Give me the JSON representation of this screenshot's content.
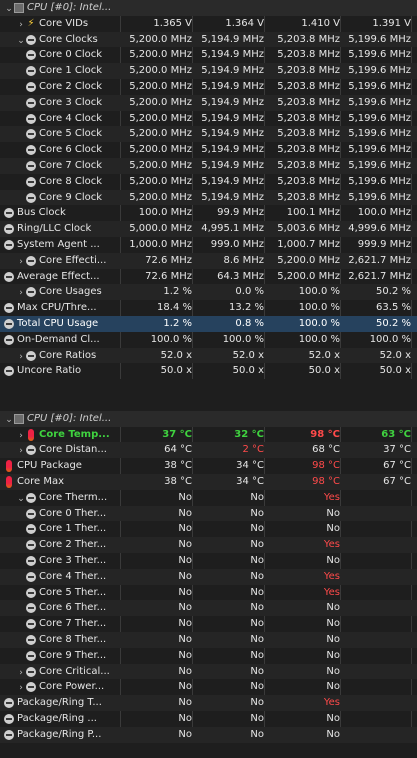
{
  "colors": {
    "green": "#3fd23f",
    "red": "#ff4a4a",
    "selected_bg": "#26425e"
  },
  "rows": [
    {
      "type": "group",
      "label": "CPU [#0]: Intel...",
      "icon": "hardware-icon",
      "arrow": "expanded"
    },
    {
      "indent": 1,
      "arrow": "collapsed",
      "icon": "lightning-icon",
      "label": "Core VIDs",
      "v": [
        "1.365 V",
        "1.364 V",
        "1.410 V",
        "1.391 V"
      ]
    },
    {
      "indent": 1,
      "arrow": "expanded",
      "icon": "circle-minus-icon",
      "label": "Core Clocks",
      "v": [
        "5,200.0 MHz",
        "5,194.9 MHz",
        "5,203.8 MHz",
        "5,199.6 MHz"
      ]
    },
    {
      "indent": 2,
      "icon": "circle-minus-icon",
      "label": "Core 0 Clock",
      "v": [
        "5,200.0 MHz",
        "5,194.9 MHz",
        "5,203.8 MHz",
        "5,199.6 MHz"
      ]
    },
    {
      "indent": 2,
      "icon": "circle-minus-icon",
      "label": "Core 1 Clock",
      "v": [
        "5,200.0 MHz",
        "5,194.9 MHz",
        "5,203.8 MHz",
        "5,199.6 MHz"
      ]
    },
    {
      "indent": 2,
      "icon": "circle-minus-icon",
      "label": "Core 2 Clock",
      "v": [
        "5,200.0 MHz",
        "5,194.9 MHz",
        "5,203.8 MHz",
        "5,199.6 MHz"
      ]
    },
    {
      "indent": 2,
      "icon": "circle-minus-icon",
      "label": "Core 3 Clock",
      "v": [
        "5,200.0 MHz",
        "5,194.9 MHz",
        "5,203.8 MHz",
        "5,199.6 MHz"
      ]
    },
    {
      "indent": 2,
      "icon": "circle-minus-icon",
      "label": "Core 4 Clock",
      "v": [
        "5,200.0 MHz",
        "5,194.9 MHz",
        "5,203.8 MHz",
        "5,199.6 MHz"
      ]
    },
    {
      "indent": 2,
      "icon": "circle-minus-icon",
      "label": "Core 5 Clock",
      "v": [
        "5,200.0 MHz",
        "5,194.9 MHz",
        "5,203.8 MHz",
        "5,199.6 MHz"
      ]
    },
    {
      "indent": 2,
      "icon": "circle-minus-icon",
      "label": "Core 6 Clock",
      "v": [
        "5,200.0 MHz",
        "5,194.9 MHz",
        "5,203.8 MHz",
        "5,199.6 MHz"
      ]
    },
    {
      "indent": 2,
      "icon": "circle-minus-icon",
      "label": "Core 7 Clock",
      "v": [
        "5,200.0 MHz",
        "5,194.9 MHz",
        "5,203.8 MHz",
        "5,199.6 MHz"
      ]
    },
    {
      "indent": 2,
      "icon": "circle-minus-icon",
      "label": "Core 8 Clock",
      "v": [
        "5,200.0 MHz",
        "5,194.9 MHz",
        "5,203.8 MHz",
        "5,199.6 MHz"
      ]
    },
    {
      "indent": 2,
      "icon": "circle-minus-icon",
      "label": "Core 9 Clock",
      "v": [
        "5,200.0 MHz",
        "5,194.9 MHz",
        "5,203.8 MHz",
        "5,199.6 MHz"
      ]
    },
    {
      "indent": 0,
      "icon": "circle-minus-icon",
      "label": "Bus Clock",
      "v": [
        "100.0 MHz",
        "99.9 MHz",
        "100.1 MHz",
        "100.0 MHz"
      ]
    },
    {
      "indent": 0,
      "icon": "circle-minus-icon",
      "label": "Ring/LLC Clock",
      "v": [
        "5,000.0 MHz",
        "4,995.1 MHz",
        "5,003.6 MHz",
        "4,999.6 MHz"
      ]
    },
    {
      "indent": 0,
      "icon": "circle-minus-icon",
      "label": "System Agent ...",
      "v": [
        "1,000.0 MHz",
        "999.0 MHz",
        "1,000.7 MHz",
        "999.9 MHz"
      ]
    },
    {
      "indent": 1,
      "arrow": "collapsed",
      "icon": "circle-minus-icon",
      "label": "Core Effecti...",
      "v": [
        "72.6 MHz",
        "8.6 MHz",
        "5,200.0 MHz",
        "2,621.7 MHz"
      ]
    },
    {
      "indent": 0,
      "icon": "circle-minus-icon",
      "label": "Average Effect...",
      "v": [
        "72.6 MHz",
        "64.3 MHz",
        "5,200.0 MHz",
        "2,621.7 MHz"
      ]
    },
    {
      "indent": 1,
      "arrow": "collapsed",
      "icon": "circle-minus-icon",
      "label": "Core Usages",
      "v": [
        "1.2 %",
        "0.0 %",
        "100.0 %",
        "50.2 %"
      ]
    },
    {
      "indent": 0,
      "icon": "circle-minus-icon",
      "label": "Max CPU/Thre...",
      "v": [
        "18.4 %",
        "13.2 %",
        "100.0 %",
        "63.5 %"
      ]
    },
    {
      "indent": 0,
      "icon": "circle-minus-icon",
      "label": "Total CPU Usage",
      "v": [
        "1.2 %",
        "0.8 %",
        "100.0 %",
        "50.2 %"
      ],
      "selected": true
    },
    {
      "indent": 0,
      "icon": "circle-minus-icon",
      "label": "On-Demand Cl...",
      "v": [
        "100.0 %",
        "100.0 %",
        "100.0 %",
        "100.0 %"
      ]
    },
    {
      "indent": 1,
      "arrow": "collapsed",
      "icon": "circle-minus-icon",
      "label": "Core Ratios",
      "v": [
        "52.0 x",
        "52.0 x",
        "52.0 x",
        "52.0 x"
      ]
    },
    {
      "indent": 0,
      "icon": "circle-minus-icon",
      "label": "Uncore Ratio",
      "v": [
        "50.0 x",
        "50.0 x",
        "50.0 x",
        "50.0 x"
      ]
    },
    {
      "type": "blank"
    },
    {
      "type": "blank"
    },
    {
      "type": "group",
      "label": "CPU [#0]: Intel...",
      "icon": "hardware-icon",
      "arrow": "expanded"
    },
    {
      "indent": 1,
      "arrow": "collapsed",
      "icon": "thermometer-icon",
      "label": "Core Temp...",
      "v": [
        "37 °C",
        "32 °C",
        "98 °C",
        "63 °C"
      ],
      "cls": [
        "green",
        "green",
        "redb",
        "green"
      ],
      "labelcls": "green"
    },
    {
      "indent": 1,
      "arrow": "collapsed",
      "icon": "circle-minus-icon",
      "label": "Core Distan...",
      "v": [
        "64 °C",
        "2 °C",
        "68 °C",
        "37 °C"
      ],
      "cls": [
        "",
        "red",
        "",
        ""
      ]
    },
    {
      "indent": 0,
      "icon": "thermometer-icon",
      "label": "CPU Package",
      "v": [
        "38 °C",
        "34 °C",
        "98 °C",
        "67 °C"
      ],
      "cls": [
        "",
        "",
        "red",
        ""
      ]
    },
    {
      "indent": 0,
      "icon": "thermometer-icon",
      "label": "Core Max",
      "v": [
        "38 °C",
        "34 °C",
        "98 °C",
        "67 °C"
      ],
      "cls": [
        "",
        "",
        "red",
        ""
      ]
    },
    {
      "indent": 1,
      "arrow": "expanded",
      "icon": "circle-minus-icon",
      "label": "Core Therm...",
      "v": [
        "No",
        "No",
        "Yes",
        ""
      ],
      "cls": [
        "",
        "",
        "red",
        ""
      ]
    },
    {
      "indent": 2,
      "icon": "circle-minus-icon",
      "label": "Core 0 Ther...",
      "v": [
        "No",
        "No",
        "No",
        ""
      ]
    },
    {
      "indent": 2,
      "icon": "circle-minus-icon",
      "label": "Core 1 Ther...",
      "v": [
        "No",
        "No",
        "No",
        ""
      ]
    },
    {
      "indent": 2,
      "icon": "circle-minus-icon",
      "label": "Core 2 Ther...",
      "v": [
        "No",
        "No",
        "Yes",
        ""
      ],
      "cls": [
        "",
        "",
        "red",
        ""
      ]
    },
    {
      "indent": 2,
      "icon": "circle-minus-icon",
      "label": "Core 3 Ther...",
      "v": [
        "No",
        "No",
        "No",
        ""
      ]
    },
    {
      "indent": 2,
      "icon": "circle-minus-icon",
      "label": "Core 4 Ther...",
      "v": [
        "No",
        "No",
        "Yes",
        ""
      ],
      "cls": [
        "",
        "",
        "red",
        ""
      ]
    },
    {
      "indent": 2,
      "icon": "circle-minus-icon",
      "label": "Core 5 Ther...",
      "v": [
        "No",
        "No",
        "Yes",
        ""
      ],
      "cls": [
        "",
        "",
        "red",
        ""
      ]
    },
    {
      "indent": 2,
      "icon": "circle-minus-icon",
      "label": "Core 6 Ther...",
      "v": [
        "No",
        "No",
        "No",
        ""
      ]
    },
    {
      "indent": 2,
      "icon": "circle-minus-icon",
      "label": "Core 7 Ther...",
      "v": [
        "No",
        "No",
        "No",
        ""
      ]
    },
    {
      "indent": 2,
      "icon": "circle-minus-icon",
      "label": "Core 8 Ther...",
      "v": [
        "No",
        "No",
        "No",
        ""
      ]
    },
    {
      "indent": 2,
      "icon": "circle-minus-icon",
      "label": "Core 9 Ther...",
      "v": [
        "No",
        "No",
        "No",
        ""
      ]
    },
    {
      "indent": 1,
      "arrow": "collapsed",
      "icon": "circle-minus-icon",
      "label": "Core Critical...",
      "v": [
        "No",
        "No",
        "No",
        ""
      ]
    },
    {
      "indent": 1,
      "arrow": "collapsed",
      "icon": "circle-minus-icon",
      "label": "Core Power...",
      "v": [
        "No",
        "No",
        "No",
        ""
      ]
    },
    {
      "indent": 0,
      "icon": "circle-minus-icon",
      "label": "Package/Ring T...",
      "v": [
        "No",
        "No",
        "Yes",
        ""
      ],
      "cls": [
        "",
        "",
        "red",
        ""
      ]
    },
    {
      "indent": 0,
      "icon": "circle-minus-icon",
      "label": "Package/Ring ...",
      "v": [
        "No",
        "No",
        "No",
        ""
      ]
    },
    {
      "indent": 0,
      "icon": "circle-minus-icon",
      "label": "Package/Ring P...",
      "v": [
        "No",
        "No",
        "No",
        ""
      ]
    },
    {
      "type": "blank"
    }
  ]
}
